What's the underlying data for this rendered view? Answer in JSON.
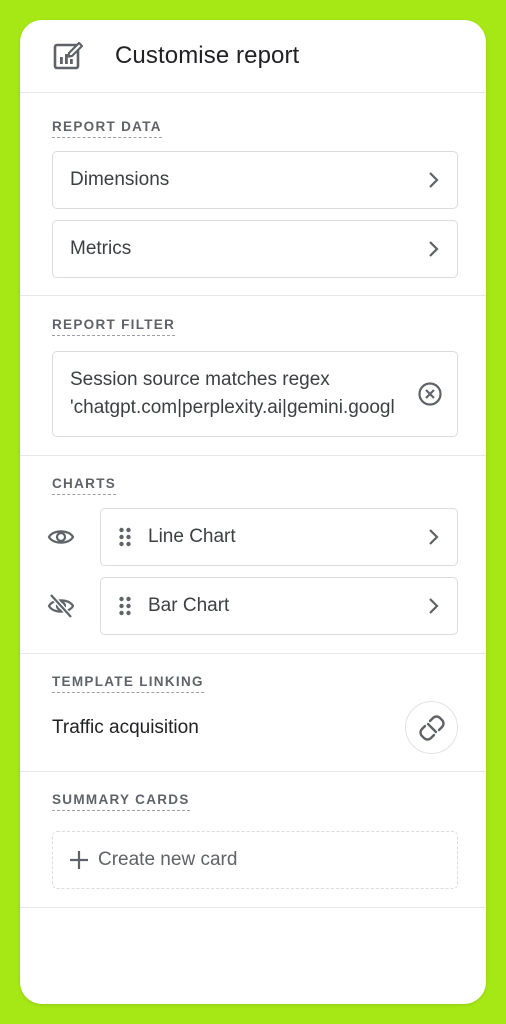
{
  "header": {
    "title": "Customise report",
    "icon": "edit-report-icon"
  },
  "report_data": {
    "label": "REPORT DATA",
    "items": [
      {
        "label": "Dimensions"
      },
      {
        "label": "Metrics"
      }
    ]
  },
  "report_filter": {
    "label": "REPORT FILTER",
    "line1": "Session source matches regex",
    "line2": "'chatgpt.com|perplexity.ai|gemini.googl"
  },
  "charts": {
    "label": "CHARTS",
    "items": [
      {
        "label": "Line Chart",
        "visible": true
      },
      {
        "label": "Bar Chart",
        "visible": false
      }
    ]
  },
  "template_linking": {
    "label": "TEMPLATE LINKING",
    "template": "Traffic acquisition"
  },
  "summary_cards": {
    "label": "SUMMARY CARDS",
    "create_label": "Create new card"
  },
  "colors": {
    "background": "#a6e815",
    "text": "#3c4043",
    "border": "#dadce0"
  }
}
